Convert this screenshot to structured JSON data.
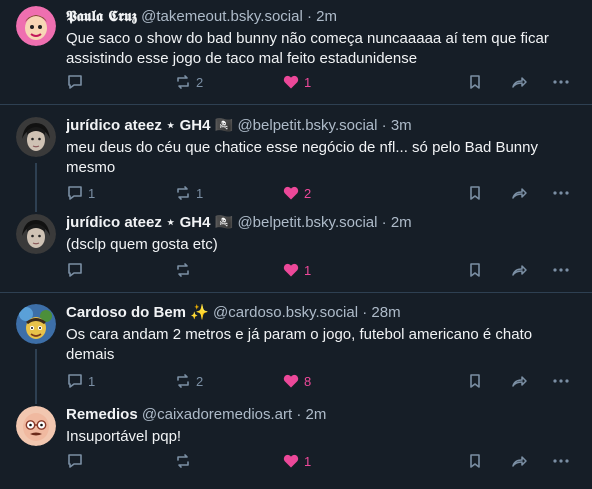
{
  "posts": [
    {
      "name": "𝕻𝖆𝖚𝖑𝖆 𝕮𝖗𝖚𝖟",
      "handle": "@takemeout.bsky.social",
      "sep": "·",
      "time": "2m",
      "text": "Que saco o show do bad bunny não começa nuncaaaaa aí tem que ficar assistindo esse jogo de taco mal feito estadunidense",
      "replies": "",
      "reposts": "2",
      "likes": "1",
      "avatar": "pink-cartoon-avatar"
    },
    {
      "name": "jurídico ateez ⋆ GH4 🏴‍☠️",
      "handle": "@belpetit.bsky.social",
      "sep": "·",
      "time": "3m",
      "text": "meu deus do céu que chatice esse negócio de nfl... só pelo Bad Bunny mesmo",
      "replies": "1",
      "reposts": "1",
      "likes": "2",
      "avatar": "dark-photo-avatar"
    },
    {
      "name": "jurídico ateez ⋆ GH4 🏴‍☠️",
      "handle": "@belpetit.bsky.social",
      "sep": "·",
      "time": "2m",
      "text": "(dsclp quem gosta etc)",
      "replies": "",
      "reposts": "",
      "likes": "1",
      "avatar": "dark-photo-avatar"
    },
    {
      "name": "Cardoso do Bem ✨",
      "handle": "@cardoso.bsky.social",
      "sep": "·",
      "time": "28m",
      "text": "Os cara andam 2 metros e já param o jogo, futebol americano é chato demais",
      "replies": "1",
      "reposts": "2",
      "likes": "8",
      "avatar": "cartoon-character-avatar"
    },
    {
      "name": "Remedios",
      "handle": "@caixadoremedios.art",
      "sep": "·",
      "time": "2m",
      "text": "Insuportável pqp!",
      "replies": "",
      "reposts": "",
      "likes": "1",
      "avatar": "bald-glasses-avatar"
    }
  ],
  "colors": {
    "background": "#161e27",
    "divider": "#2e4052",
    "muted": "#aebbc9",
    "icon": "#7b8fa4",
    "like": "#ec4899"
  },
  "icons": [
    "reply-icon",
    "repost-icon",
    "heart-icon",
    "bookmark-icon",
    "share-icon",
    "more-icon"
  ]
}
